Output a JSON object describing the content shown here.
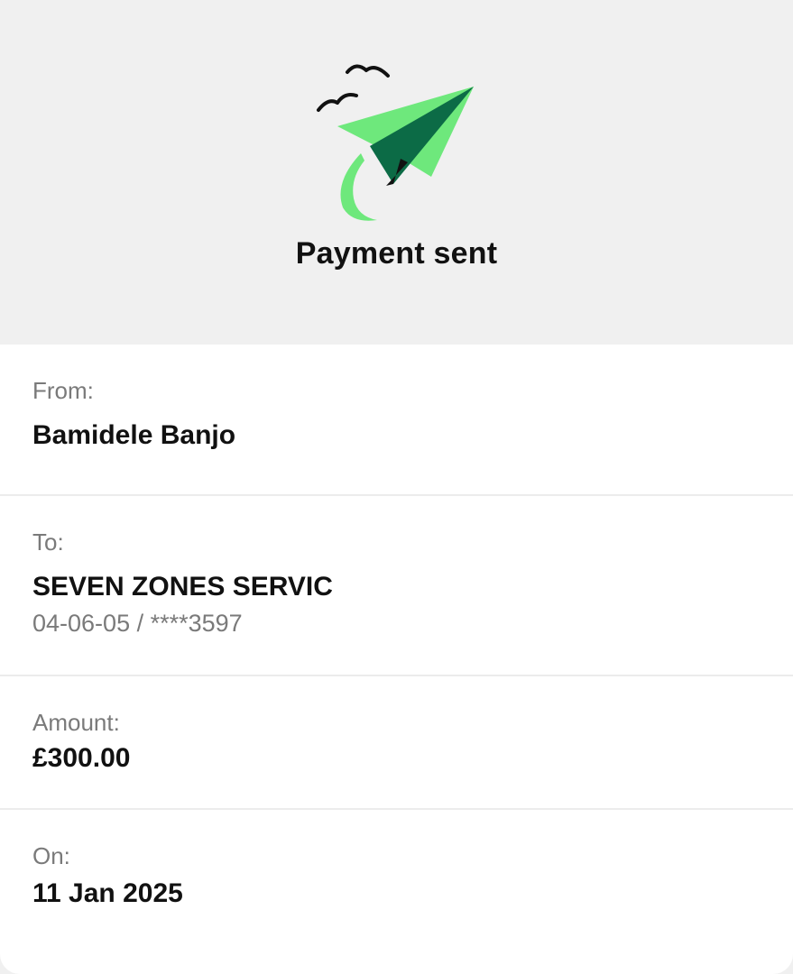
{
  "header": {
    "title": "Payment sent",
    "icon": "paper-plane-icon",
    "accent_light": "#6ee87c",
    "accent_dark": "#0c6b46"
  },
  "details": {
    "from": {
      "label": "From:",
      "value": "Bamidele Banjo"
    },
    "to": {
      "label": "To:",
      "value": "SEVEN ZONES SERVIC",
      "account": "04-06-05 / ****3597"
    },
    "amount": {
      "label": "Amount:",
      "value": "£300.00"
    },
    "on": {
      "label": "On:",
      "value": "11 Jan 2025"
    }
  }
}
